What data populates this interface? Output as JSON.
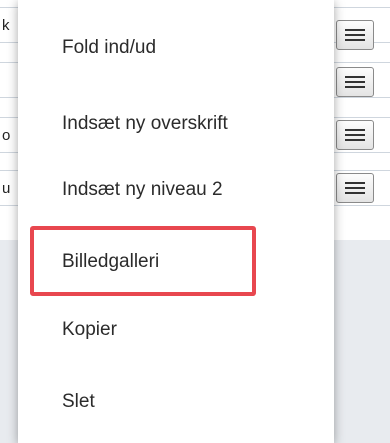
{
  "background_rows": [
    {
      "text": "k"
    },
    {
      "text": ""
    },
    {
      "text": "o"
    },
    {
      "text": "u"
    }
  ],
  "icons": {
    "row_menu": "hamburger-menu-icon"
  },
  "context_menu": {
    "items": [
      {
        "label": "Fold ind/ud"
      },
      {
        "label": "Indsæt ny overskrift"
      },
      {
        "label": "Indsæt ny niveau 2"
      },
      {
        "label": "Billedgalleri"
      },
      {
        "label": "Kopier"
      },
      {
        "label": "Slet"
      }
    ],
    "highlighted_index": 3
  },
  "colors": {
    "highlight": "#e8474f",
    "page_background": "#e8ebef"
  }
}
